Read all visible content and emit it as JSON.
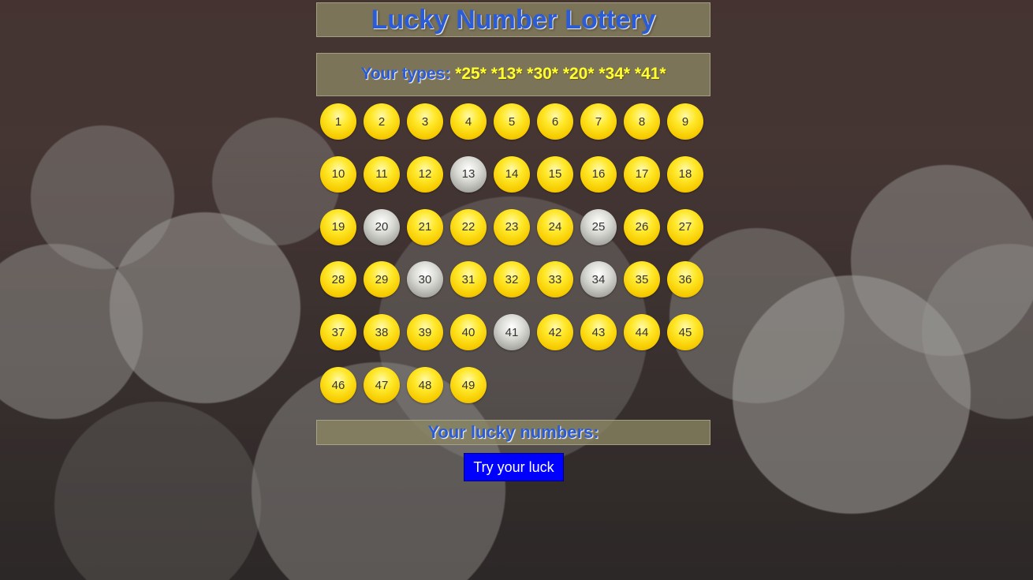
{
  "header": {
    "title": "Lucky Number Lottery"
  },
  "types": {
    "label": "Your types:",
    "values": "*25* *13* *30* *20* *34* *41*",
    "selected": [
      25,
      13,
      30,
      20,
      34,
      41
    ]
  },
  "grid": {
    "numbers": [
      1,
      2,
      3,
      4,
      5,
      6,
      7,
      8,
      9,
      10,
      11,
      12,
      13,
      14,
      15,
      16,
      17,
      18,
      19,
      20,
      21,
      22,
      23,
      24,
      25,
      26,
      27,
      28,
      29,
      30,
      31,
      32,
      33,
      34,
      35,
      36,
      37,
      38,
      39,
      40,
      41,
      42,
      43,
      44,
      45,
      46,
      47,
      48,
      49
    ],
    "columns": 9
  },
  "lucky": {
    "label": "Your lucky numbers:"
  },
  "actions": {
    "try_label": "Try your luck"
  },
  "colors": {
    "title_blue": "#2b5cd6",
    "types_yellow": "#ffff33",
    "ball_yellow": "#ffe82a",
    "ball_picked_gray": "#c8c8c4",
    "button_blue": "#0000ff"
  }
}
